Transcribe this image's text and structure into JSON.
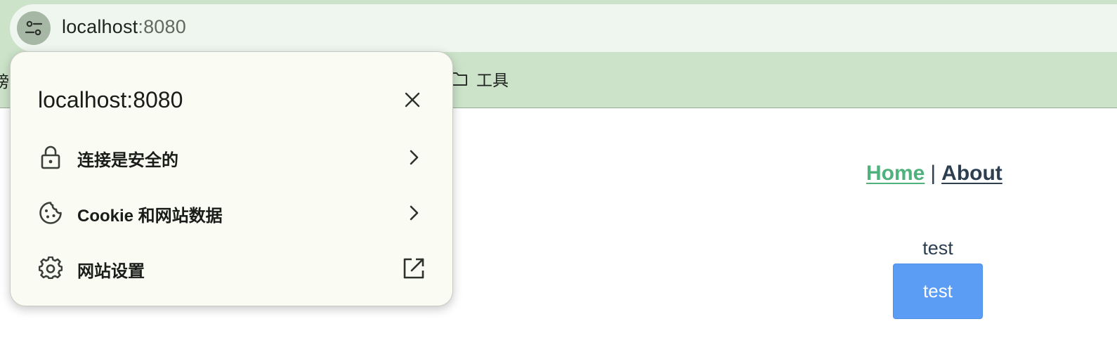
{
  "browser": {
    "url_host": "localhost",
    "url_port": ":8080",
    "bookmark_cut_label": "谤站",
    "bookmark_tools_label": "工具"
  },
  "popup": {
    "title": "localhost:8080",
    "rows": [
      {
        "label": "连接是安全的",
        "icon": "lock-icon",
        "trailing_icon": "chevron-right-icon"
      },
      {
        "label": "Cookie 和网站数据",
        "icon": "cookie-icon",
        "trailing_icon": "chevron-right-icon"
      },
      {
        "label": "网站设置",
        "icon": "gear-icon",
        "trailing_icon": "open-in-new-icon"
      }
    ]
  },
  "page": {
    "nav": {
      "home_label": "Home",
      "separator": "|",
      "about_label": "About"
    },
    "test_text": "test",
    "test_button_label": "test"
  },
  "colors": {
    "chrome_bg": "#cce3c9",
    "omnibox_bg": "#eff6ef",
    "popup_bg": "#fafbf3",
    "nav_home": "#4fb27d",
    "nav_about": "#2c3e50",
    "button_bg": "#5b9cf5"
  }
}
